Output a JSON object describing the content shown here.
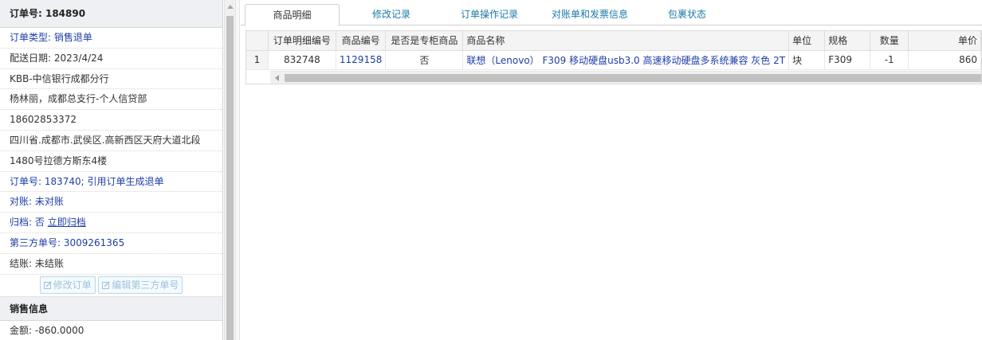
{
  "order": {
    "header": "订单号: 184890",
    "type": "订单类型: 销售退单",
    "delivery_date": "配送日期: 2023/4/24",
    "org": "KBB-中信银行成都分行",
    "contact": "杨林丽，成都总支行-个人信贷部",
    "phone": "18602853372",
    "address_line1": "四川省.成都市.武侯区.高新西区天府大道北段",
    "address_line2": "1480号拉德方斯东4楼",
    "ref_order": "订单号: 183740; 引用订单生成退单",
    "reconcile": "对账: 未对账",
    "archive_label": "归档: ",
    "archive_value": "否",
    "archive_link": "立即归档",
    "third_party": "第三方单号: 3009261365",
    "settle": "结账: 未结账",
    "edit_order_btn": "修改订单",
    "edit_third_btn": "编辑第三方单号"
  },
  "sales": {
    "header": "销售信息",
    "amount": "金额: -860.0000"
  },
  "tabs": [
    {
      "label": "商品明细",
      "active": true
    },
    {
      "label": "修改记录",
      "active": false
    },
    {
      "label": "订单操作记录",
      "active": false
    },
    {
      "label": "对账单和发票信息",
      "active": false
    },
    {
      "label": "包裹状态",
      "active": false
    }
  ],
  "grid": {
    "columns": [
      "",
      "订单明细编号",
      "商品编号",
      "是否是专柜商品",
      "商品名称",
      "单位",
      "规格",
      "数量",
      "单价"
    ],
    "rows": [
      [
        "1",
        "832748",
        "1129158",
        "否",
        "联想（Lenovo） F309 移动硬盘usb3.0 高速移动硬盘多系统兼容 灰色 2T",
        "块",
        "F309",
        "-1",
        "860"
      ]
    ]
  },
  "colors": {
    "link": "#1f3ea8",
    "tab_text": "#1c7aa8",
    "header_bg": "#eef0f3"
  }
}
